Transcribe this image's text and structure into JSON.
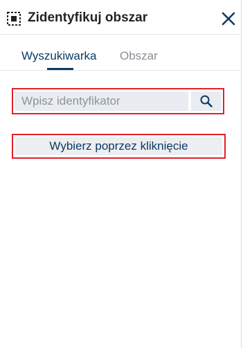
{
  "header": {
    "title": "Zidentyfikuj obszar",
    "icon": "select-area-icon",
    "close_icon": "close-icon"
  },
  "tabs": [
    {
      "label": "Wyszukiwarka",
      "active": true
    },
    {
      "label": "Obszar",
      "active": false
    }
  ],
  "search": {
    "placeholder": "Wpisz identyfikator",
    "value": "",
    "button_icon": "search-icon"
  },
  "select_button": {
    "label": "Wybierz poprzez kliknięcie"
  },
  "colors": {
    "accent": "#0b3a63",
    "highlight_border": "#e0202a",
    "input_bg": "#e9ecf0",
    "inactive_tab": "#8a8f96"
  }
}
